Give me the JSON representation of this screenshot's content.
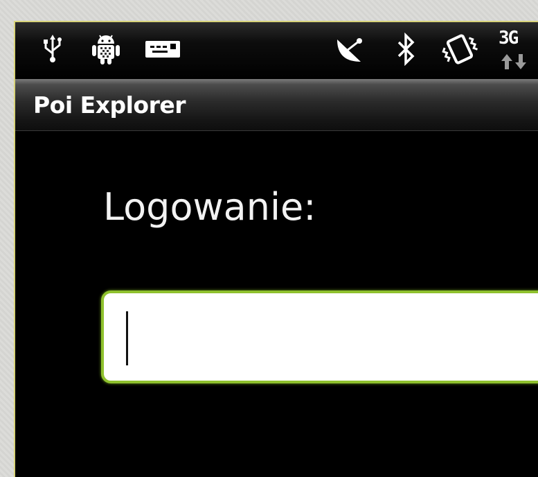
{
  "status_bar": {
    "icons": [
      "usb-icon",
      "android-debug-icon",
      "sd-card-icon",
      "satellite-dish-icon",
      "bluetooth-icon",
      "vibrate-icon",
      "network-3g-icon"
    ],
    "network_type": "3G"
  },
  "app": {
    "title": "Poi Explorer"
  },
  "login": {
    "label": "Logowanie:",
    "input_value": "",
    "input_placeholder": ""
  },
  "colors": {
    "input_border": "#8fc12e",
    "background": "#000000",
    "text": "#ffffff"
  }
}
